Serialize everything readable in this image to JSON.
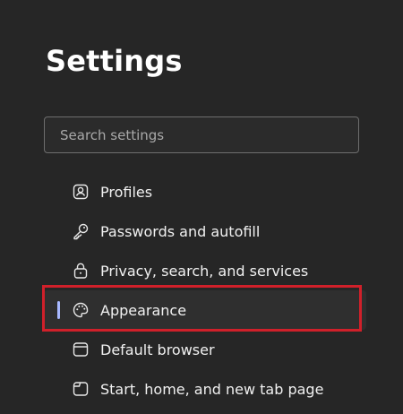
{
  "settings": {
    "title": "Settings",
    "search": {
      "placeholder": "Search settings",
      "value": ""
    },
    "nav": [
      {
        "label": "Profiles",
        "icon": "profile-icon",
        "selected": false
      },
      {
        "label": "Passwords and autofill",
        "icon": "key-icon",
        "selected": false
      },
      {
        "label": "Privacy, search, and services",
        "icon": "lock-icon",
        "selected": false
      },
      {
        "label": "Appearance",
        "icon": "palette-icon",
        "selected": true
      },
      {
        "label": "Default browser",
        "icon": "browser-icon",
        "selected": false
      },
      {
        "label": "Start, home, and new tab page",
        "icon": "home-tab-icon",
        "selected": false
      }
    ]
  },
  "colors": {
    "background": "#262626",
    "text": "#f1f1f1",
    "selected_indicator": "#a7b8ff",
    "highlight_border": "#d0202a"
  }
}
